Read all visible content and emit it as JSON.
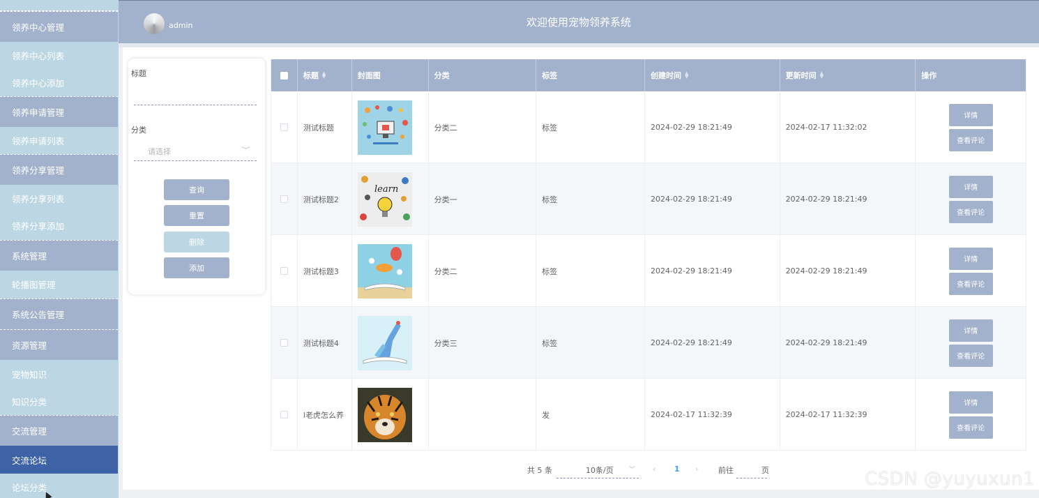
{
  "header": {
    "username": "admin",
    "title": "欢迎使用宠物领养系统"
  },
  "sidebar": {
    "items": [
      {
        "label": "领养中心管理",
        "kind": "group"
      },
      {
        "label": "领养中心列表",
        "kind": "sub"
      },
      {
        "label": "领养中心添加",
        "kind": "sub"
      },
      {
        "label": "领养申请管理",
        "kind": "group"
      },
      {
        "label": "领养申请列表",
        "kind": "sub"
      },
      {
        "label": "领养分享管理",
        "kind": "group"
      },
      {
        "label": "领养分享列表",
        "kind": "sub"
      },
      {
        "label": "领养分享添加",
        "kind": "sub"
      },
      {
        "label": "系统管理",
        "kind": "group"
      },
      {
        "label": "轮播图管理",
        "kind": "sub"
      },
      {
        "label": "系统公告管理",
        "kind": "group"
      },
      {
        "label": "资源管理",
        "kind": "group"
      },
      {
        "label": "宠物知识",
        "kind": "sub"
      },
      {
        "label": "知识分类",
        "kind": "sub"
      },
      {
        "label": "交流管理",
        "kind": "group"
      },
      {
        "label": "交流论坛",
        "kind": "active"
      },
      {
        "label": "论坛分类",
        "kind": "sub"
      }
    ]
  },
  "search": {
    "title_label": "标题",
    "category_label": "分类",
    "category_placeholder": "请选择",
    "buttons": {
      "query": "查询",
      "reset": "重置",
      "delete": "删除",
      "add": "添加"
    }
  },
  "table": {
    "columns": [
      "标题",
      "封面图",
      "分类",
      "标签",
      "创建时间",
      "更新时间",
      "操作"
    ],
    "rows": [
      {
        "title": "测试标题",
        "cover": "tech-icons",
        "category": "分类二",
        "tag": "标签",
        "created": "2024-02-29 18:21:49",
        "updated": "2024-02-17 11:32:02"
      },
      {
        "title": "测试标题2",
        "cover": "learn-bulb",
        "category": "分类一",
        "tag": "标签",
        "created": "2024-02-29 18:21:49",
        "updated": "2024-02-29 18:21:49"
      },
      {
        "title": "测试标题3",
        "cover": "book-balloon",
        "category": "分类二",
        "tag": "标签",
        "created": "2024-02-29 18:21:49",
        "updated": "2024-02-29 18:21:49"
      },
      {
        "title": "测试标题4",
        "cover": "book-splash",
        "category": "分类三",
        "tag": "标签",
        "created": "2024-02-29 18:21:49",
        "updated": "2024-02-29 18:21:49"
      },
      {
        "title": "l老虎怎么养",
        "cover": "tiger",
        "category": "",
        "tag": "发",
        "created": "2024-02-17 11:32:39",
        "updated": "2024-02-17 11:32:39"
      }
    ],
    "actions": {
      "detail": "详情",
      "comments": "查看评论"
    }
  },
  "pagination": {
    "total": "共 5 条",
    "page_size": "10条/页",
    "current_page": "1",
    "goto_prefix": "前往",
    "goto_suffix": "页"
  },
  "watermark": "CSDN @yuyuxun1",
  "colors": {
    "accent": "#a3b2cc",
    "sidebar_sub": "#bcd7e3",
    "sidebar_active": "#3f62a6"
  }
}
